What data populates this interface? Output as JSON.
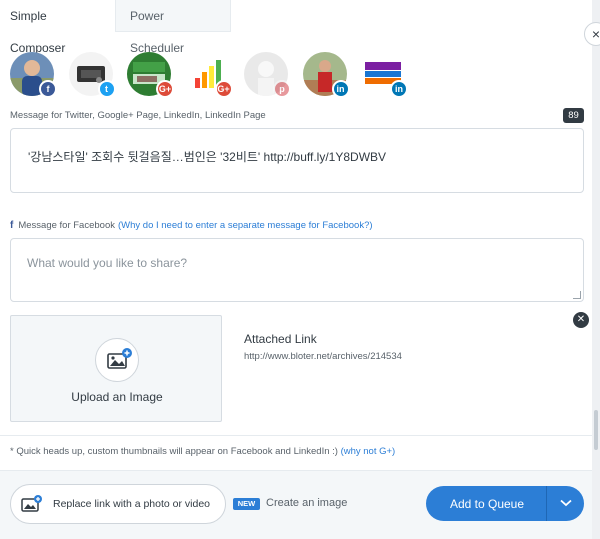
{
  "tabs": [
    {
      "label": "Simple Composer",
      "active": true
    },
    {
      "label": "Power Scheduler",
      "active": false
    }
  ],
  "close_label": "×",
  "profiles": [
    {
      "network": "facebook",
      "badge": "f",
      "selected": true
    },
    {
      "network": "twitter",
      "badge": "t",
      "selected": true
    },
    {
      "network": "google-plus",
      "badge": "G+",
      "selected": true
    },
    {
      "network": "google-plus",
      "badge": "G+",
      "selected": true
    },
    {
      "network": "pinterest",
      "badge": "p",
      "selected": false
    },
    {
      "network": "linkedin",
      "badge": "in",
      "selected": true
    },
    {
      "network": "linkedin",
      "badge": "in",
      "selected": true
    }
  ],
  "main_message": {
    "label": "Message for Twitter, Google+ Page, LinkedIn, LinkedIn Page",
    "char_count": "89",
    "text": "'강남스타일' 조회수 뒷걸음질…범인은 '32비트' http://buff.ly/1Y8DWBV"
  },
  "facebook_message": {
    "label": "Message for Facebook",
    "help_link": "(Why do I need to enter a separate message for Facebook?)",
    "placeholder": "What would you like to share?"
  },
  "upload": {
    "label": "Upload an Image"
  },
  "attached": {
    "title": "Attached Link",
    "url": "http://www.bloter.net/archives/214534"
  },
  "headsup": {
    "text": "* Quick heads up, custom thumbnails will appear on Facebook and LinkedIn :) ",
    "link": "(why not G+)"
  },
  "footer": {
    "replace_label": "Replace link with a photo or video",
    "new_badge": "NEW",
    "create_label": "Create an image",
    "queue_label": "Add to Queue"
  },
  "colors": {
    "accent": "#2c7ed6",
    "facebook": "#3b5998",
    "twitter": "#1da1f2",
    "google_plus": "#dd4b39",
    "pinterest": "#cb2027",
    "linkedin": "#0077b5"
  }
}
